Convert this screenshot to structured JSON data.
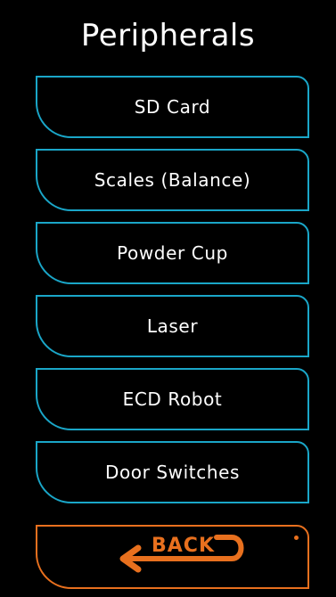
{
  "screen": {
    "title": "Peripherals"
  },
  "menu": {
    "items": [
      {
        "label": "SD Card"
      },
      {
        "label": "Scales (Balance)"
      },
      {
        "label": "Powder Cup"
      },
      {
        "label": "Laser"
      },
      {
        "label": "ECD Robot"
      },
      {
        "label": "Door Switches"
      }
    ]
  },
  "back": {
    "label": "BACK",
    "icon": "back-arrow-icon"
  },
  "colors": {
    "background": "#000000",
    "menu_border": "#1aa6c8",
    "back_accent": "#e8701e",
    "text": "#ffffff"
  }
}
